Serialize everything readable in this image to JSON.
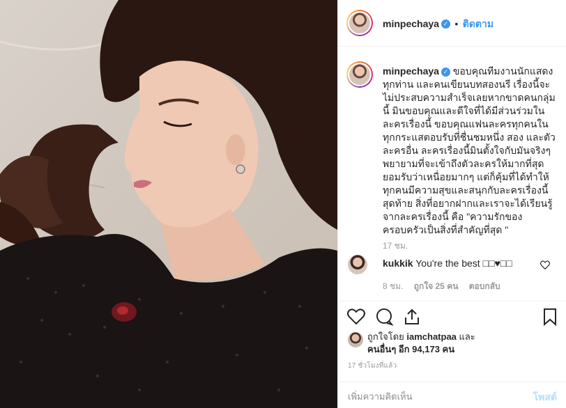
{
  "post": {
    "username": "minpechaya",
    "follow_label": "ติดตาม",
    "dot": "•",
    "verified_glyph": "✓"
  },
  "caption": {
    "username": "minpechaya",
    "text": "ขอบคุณทีมงานนักแสดงทุกท่าน และคนเขียนบทสองนรี เรื่องนี้จะไม่ประสบความสำเร็จเลยหากขาดคนกลุ่มนี้ มินขอบคุณและดีใจที่ได้มีส่วนร่วมในละครเรื่องนี้ ขอบคุณแฟนละครทุกคนในทุกกระแสตอบรับที่ชื่นชมหนึ่ง สอง และตัวละครอื่น ละครเรื่องนี้มินตั้งใจกับมันจริงๆ พยายามที่จะเข้าถึงตัวละครให้มากที่สุด ยอมรับว่าเหนื่อยมากๆ แต่ก็คุ้มที่ได้ทำให้ทุกคนมีความสุขและสนุกกับละครเรื่องนี้ สุดท้าย สิ่งที่อยากฝากและเราจะได้เรียนรู้จากละครเรื่องนี้ คือ \"ความรักของครอบครัวเป็นสิ่งที่สำคัญที่สุด \"",
    "time": "17 ชม."
  },
  "comment": {
    "username": "kukkik",
    "text": "You're the best □□♥□□",
    "time": "8 ชม.",
    "likes": "ถูกใจ 25 คน",
    "reply": "ตอบกลับ"
  },
  "likes": {
    "prefix": "ถูกใจโดย",
    "user": "iamchatpaa",
    "and": "และ",
    "others": "คนอื่นๆ อีก 94,173 คน"
  },
  "post_time": "17 ชั่วโมงที่แล้ว",
  "comment_box": {
    "placeholder": "เพิ่มความคิดเห็น",
    "post_label": "โพสต์"
  },
  "colors": {
    "accent": "#3897f0",
    "post_disabled": "#b2dffc",
    "muted": "#999999",
    "text": "#262626"
  },
  "icons": [
    "heart-icon",
    "comment-icon",
    "share-icon",
    "bookmark-icon",
    "verified-badge-icon",
    "small-heart-icon"
  ]
}
